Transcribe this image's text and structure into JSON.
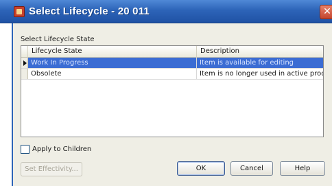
{
  "window": {
    "title": "Select Lifecycle - 20 011",
    "close_glyph": "✕"
  },
  "section_label": "Select Lifecycle State",
  "table": {
    "columns": [
      "Lifecycle State",
      "Description"
    ],
    "rows": [
      {
        "state": "Work In Progress",
        "description": "Item is available for editing",
        "selected": true
      },
      {
        "state": "Obsolete",
        "description": "Item is no longer used in active production",
        "selected": false
      }
    ]
  },
  "apply_to_children": {
    "label": "Apply to Children",
    "checked": false
  },
  "buttons": {
    "set_effectivity": "Set Effectivity...",
    "ok": "OK",
    "cancel": "Cancel",
    "help": "Help"
  },
  "colors": {
    "titlebar": "#2d64b8",
    "selection": "#3b6cd3",
    "dialog_background": "#efeee5"
  },
  "icons": {
    "app": "app-icon",
    "close": "close-icon",
    "row_marker": "row-pointer-icon"
  }
}
